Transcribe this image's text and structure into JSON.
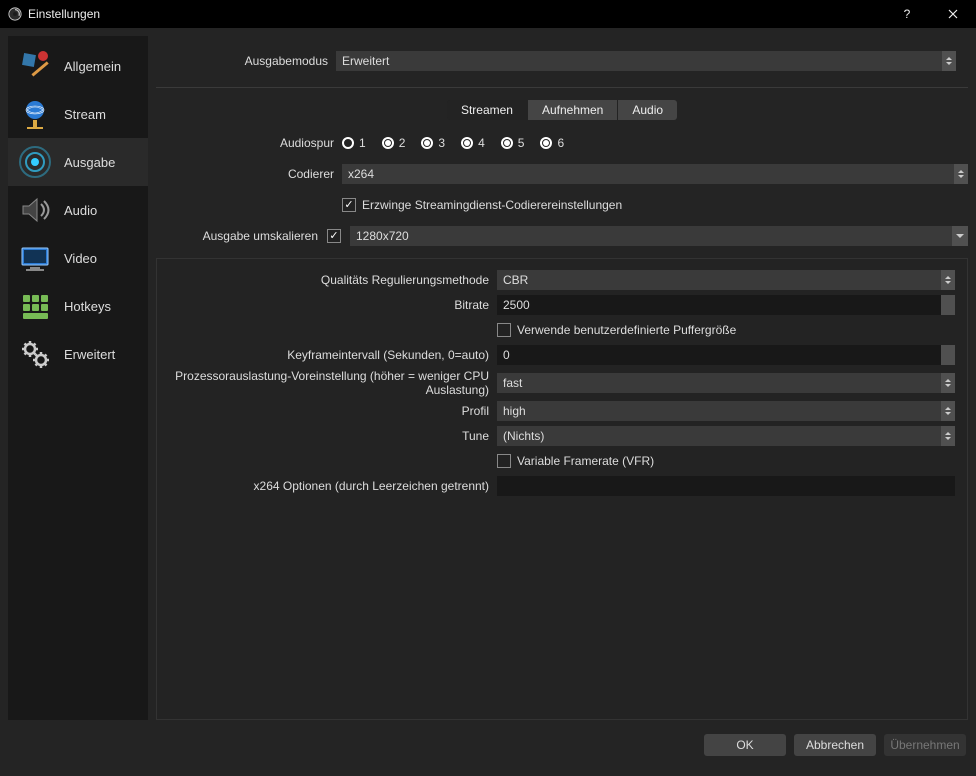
{
  "window": {
    "title": "Einstellungen"
  },
  "sidebar": {
    "items": [
      {
        "label": "Allgemein",
        "icon": "general"
      },
      {
        "label": "Stream",
        "icon": "stream"
      },
      {
        "label": "Ausgabe",
        "icon": "output",
        "active": true
      },
      {
        "label": "Audio",
        "icon": "audio"
      },
      {
        "label": "Video",
        "icon": "video"
      },
      {
        "label": "Hotkeys",
        "icon": "hotkeys"
      },
      {
        "label": "Erweitert",
        "icon": "advanced"
      }
    ]
  },
  "output_mode": {
    "label": "Ausgabemodus",
    "value": "Erweitert"
  },
  "tabs": {
    "stream": "Streamen",
    "record": "Aufnehmen",
    "audio": "Audio",
    "active": "stream"
  },
  "stream": {
    "audio_track_label": "Audiospur",
    "audio_track_options": [
      "1",
      "2",
      "3",
      "4",
      "5",
      "6"
    ],
    "audio_track_selected": "1",
    "encoder_label": "Codierer",
    "encoder_value": "x264",
    "enforce_label": "Erzwinge Streamingdienst-Codierereinstellungen",
    "enforce_checked": true,
    "rescale_label": "Ausgabe umskalieren",
    "rescale_checked": true,
    "rescale_value": "1280x720"
  },
  "encoder_settings": {
    "rate_control_label": "Qualitäts Regulierungsmethode",
    "rate_control_value": "CBR",
    "bitrate_label": "Bitrate",
    "bitrate_value": "2500",
    "custom_buffer_label": "Verwende benutzerdefinierte Puffergröße",
    "custom_buffer_checked": false,
    "keyframe_label": "Keyframeintervall (Sekunden, 0=auto)",
    "keyframe_value": "0",
    "cpu_preset_label": "Prozessorauslastung-Voreinstellung (höher = weniger CPU Auslastung)",
    "cpu_preset_value": "fast",
    "profile_label": "Profil",
    "profile_value": "high",
    "tune_label": "Tune",
    "tune_value": "(Nichts)",
    "vfr_label": "Variable Framerate (VFR)",
    "vfr_checked": false,
    "x264opts_label": "x264 Optionen (durch Leerzeichen getrennt)",
    "x264opts_value": ""
  },
  "footer": {
    "ok": "OK",
    "cancel": "Abbrechen",
    "apply": "Übernehmen"
  }
}
